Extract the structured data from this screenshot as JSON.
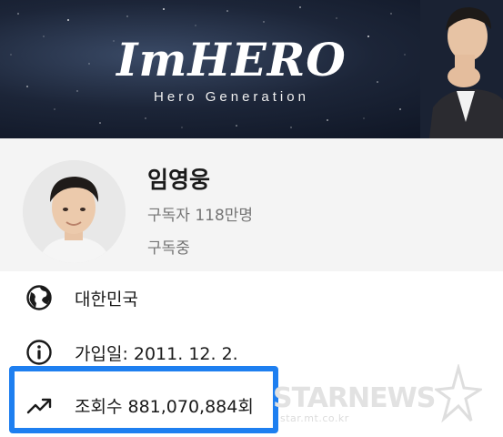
{
  "banner": {
    "title": "ImHERO",
    "subtitle": "Hero Generation"
  },
  "profile": {
    "channel_name": "임영웅",
    "subscribers": "구독자 118만명",
    "subscribe_status": "구독중"
  },
  "info": {
    "country": "대한민국",
    "joined": "가입일: 2011. 12. 2.",
    "views": "조회수 881,070,884회"
  },
  "watermark": {
    "brand": "STARNEWS",
    "url": "star.mt.co.kr"
  },
  "colors": {
    "highlight": "#1e7ff0",
    "profile_bg": "#f4f4f4",
    "secondary_text": "#757575"
  },
  "icons": {
    "country": "globe-icon",
    "joined": "info-icon",
    "views": "trending-up-icon"
  }
}
